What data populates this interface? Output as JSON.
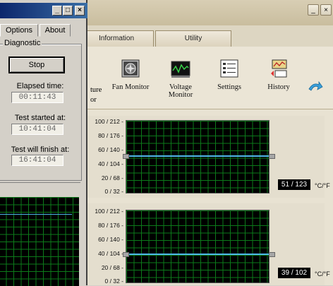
{
  "diagnostic_window": {
    "tabs": [
      {
        "label": "Options"
      },
      {
        "label": "About"
      }
    ],
    "group_title": "Diagnostic",
    "stop_label": "Stop",
    "elapsed_label": "Elapsed time:",
    "elapsed_value": "00:11:43",
    "started_label": "Test started at:",
    "started_value": "10:41:04",
    "finish_label": "Test will finish at:",
    "finish_value": "16:41:04",
    "controls": {
      "minimize": "_",
      "maximize": "□",
      "close": "×"
    }
  },
  "monitor_app": {
    "tabs": [
      {
        "label": "Information"
      },
      {
        "label": "Utility"
      }
    ],
    "toolbar": {
      "partial_a": "ture",
      "partial_b": "or",
      "fan_monitor": "Fan Monitor",
      "voltage_monitor_line1": "Voltage",
      "voltage_monitor_line2": "Monitor",
      "settings": "Settings",
      "history": "History"
    },
    "charts": [
      {
        "axis_labels": [
          "100 / 212 -",
          "80 / 176 -",
          "60 / 140 -",
          "40 / 104 -",
          "20 /  68 -",
          "0 /  32 -"
        ],
        "readout": "51 / 123",
        "unit": "°C/°F",
        "value_c": 51
      },
      {
        "axis_labels": [
          "100 / 212 -",
          "80 / 176 -",
          "60 / 140 -",
          "40 / 104 -",
          "20 /  68 -",
          "0 /  32 -"
        ],
        "readout": "39 / 102",
        "unit": "°C/°F",
        "value_c": 39
      }
    ]
  },
  "colors": {
    "trace": "#4fb6e8",
    "grid": "#0c7a1a",
    "titlebar_start": "#0a246a",
    "titlebar_end": "#3a6ea5"
  }
}
